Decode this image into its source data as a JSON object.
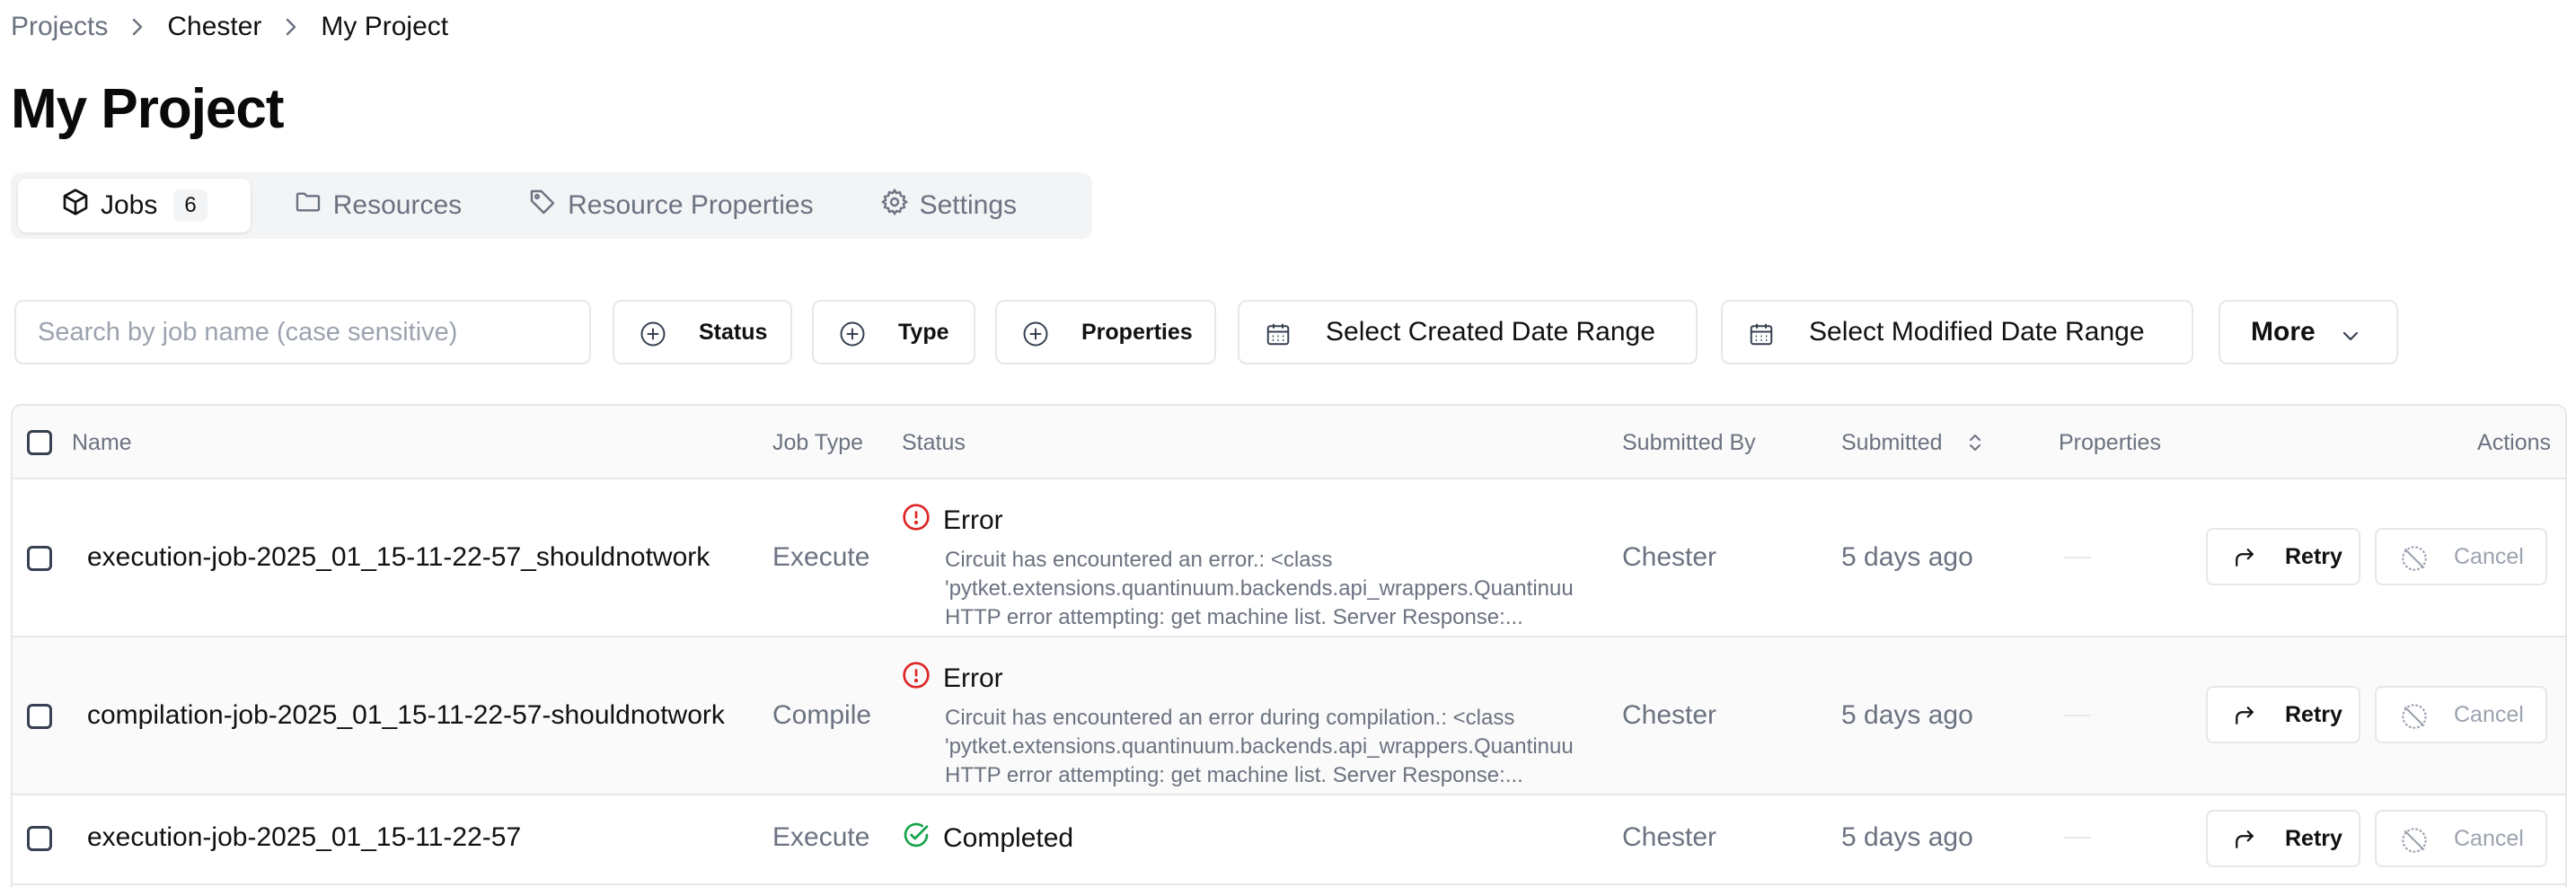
{
  "breadcrumb": {
    "items": [
      "Projects",
      "Chester",
      "My Project"
    ]
  },
  "page": {
    "title": "My Project"
  },
  "tabs": [
    {
      "label": "Jobs",
      "count": "6",
      "icon": "cube-icon"
    },
    {
      "label": "Resources",
      "icon": "folder-icon"
    },
    {
      "label": "Resource Properties",
      "icon": "tag-icon"
    },
    {
      "label": "Settings",
      "icon": "gear-icon"
    }
  ],
  "filters": {
    "search_placeholder": "Search by job name (case sensitive)",
    "status": "Status",
    "type": "Type",
    "properties": "Properties",
    "created_range": "Select Created Date Range",
    "modified_range": "Select Modified Date Range",
    "more": "More"
  },
  "table": {
    "headers": {
      "name": "Name",
      "job_type": "Job Type",
      "status": "Status",
      "submitted_by": "Submitted By",
      "submitted": "Submitted",
      "properties": "Properties",
      "actions": "Actions"
    },
    "rows": [
      {
        "name": "execution-job-2025_01_15-11-22-57_shouldnotwork",
        "job_type": "Execute",
        "status": "Error",
        "message": [
          "Circuit has encountered an error.: <class",
          "'pytket.extensions.quantinuum.backends.api_wrappers.QuantinuumAPIError'>:",
          "HTTP error attempting: get machine list. Server Response:..."
        ],
        "submitted_by": "Chester",
        "submitted": "5 days ago",
        "retry": "Retry",
        "cancel": "Cancel"
      },
      {
        "name": "compilation-job-2025_01_15-11-22-57-shouldnotwork",
        "job_type": "Compile",
        "status": "Error",
        "message": [
          "Circuit has encountered an error during compilation.: <class",
          "'pytket.extensions.quantinuum.backends.api_wrappers.QuantinuumAPIError'>:",
          "HTTP error attempting: get machine list. Server Response:..."
        ],
        "submitted_by": "Chester",
        "submitted": "5 days ago",
        "retry": "Retry",
        "cancel": "Cancel"
      },
      {
        "name": "execution-job-2025_01_15-11-22-57",
        "job_type": "Execute",
        "status": "Completed",
        "submitted_by": "Chester",
        "submitted": "5 days ago",
        "retry": "Retry",
        "cancel": "Cancel"
      }
    ]
  },
  "colors": {
    "error": "#dc2626",
    "success": "#16a34a",
    "muted": "#6b7280",
    "border": "#e5e7eb"
  }
}
